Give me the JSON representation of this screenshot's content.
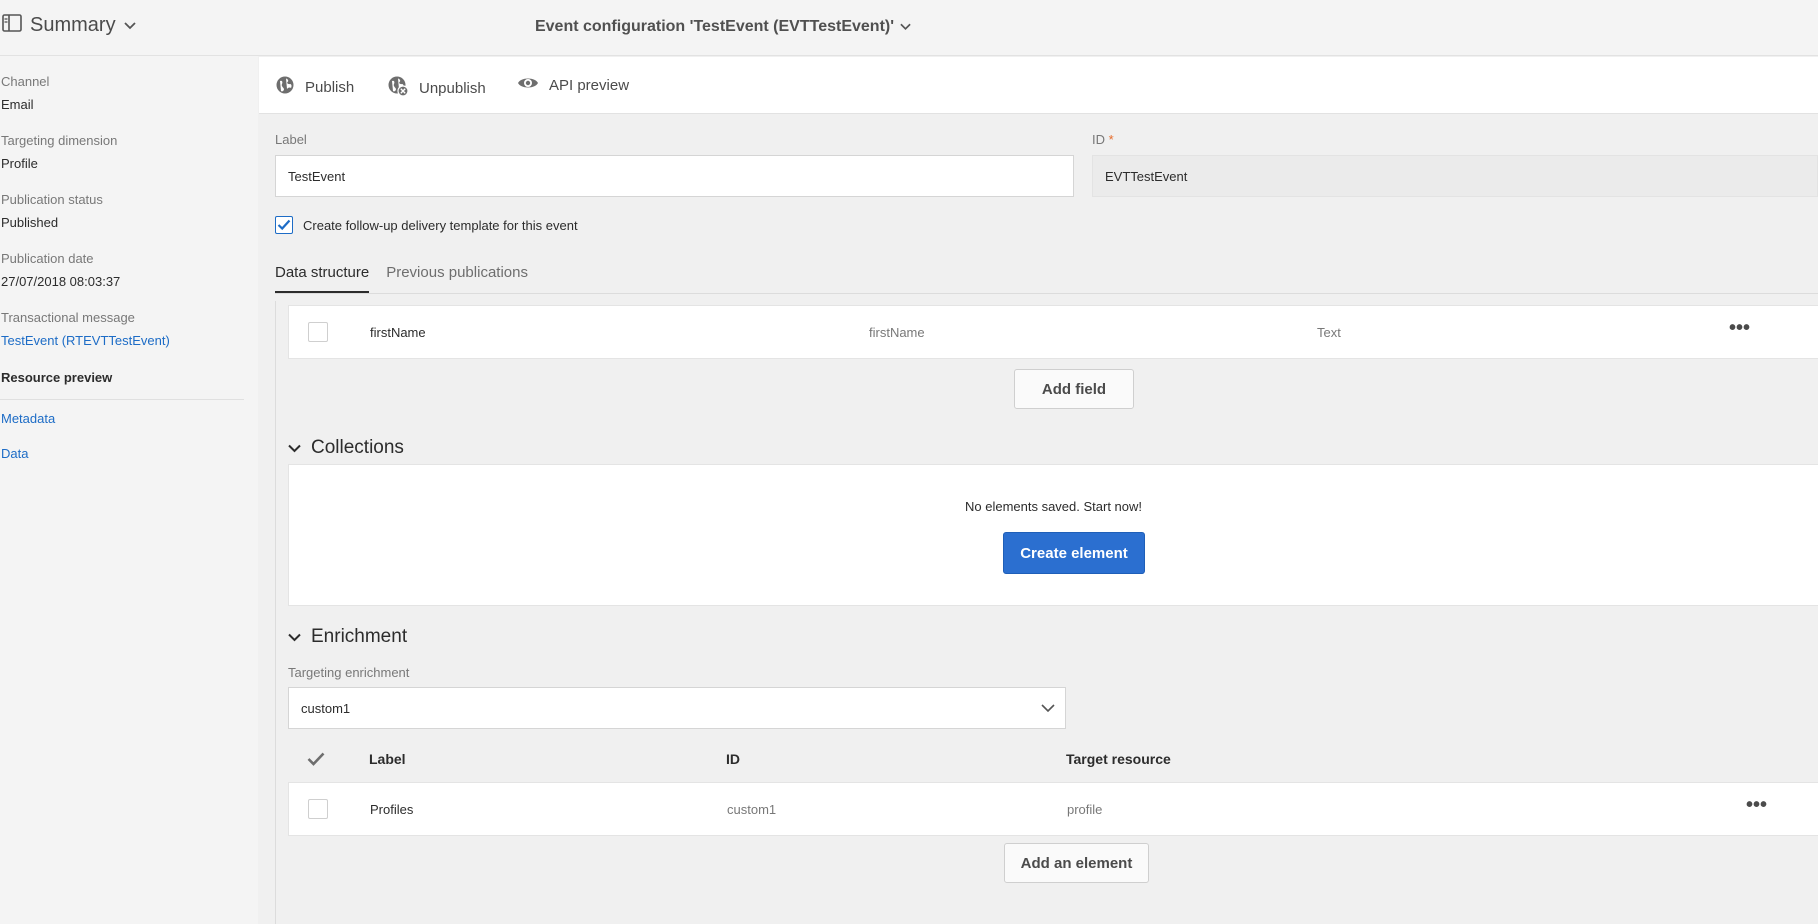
{
  "header": {
    "summary_label": "Summary",
    "title": "Event configuration 'TestEvent (EVTTestEvent)'"
  },
  "sidebar": {
    "channel_label": "Channel",
    "channel_value": "Email",
    "targeting_label": "Targeting dimension",
    "targeting_value": "Profile",
    "status_label": "Publication status",
    "status_value": "Published",
    "date_label": "Publication date",
    "date_value": "27/07/2018 08:03:37",
    "message_label": "Transactional message",
    "message_link": "TestEvent (RTEVTTestEvent)",
    "resource_preview": "Resource preview",
    "metadata_link": "Metadata",
    "data_link": "Data"
  },
  "toolbar": {
    "publish": "Publish",
    "unpublish": "Unpublish",
    "api_preview": "API preview"
  },
  "form": {
    "label_title": "Label",
    "label_value": "TestEvent",
    "id_title": "ID",
    "id_required": "*",
    "id_value": "EVTTestEvent",
    "followup_checkbox": "Create follow-up delivery template for this event",
    "followup_checked": true
  },
  "tabs": [
    {
      "label": "Data structure",
      "active": true
    },
    {
      "label": "Previous publications",
      "active": false
    }
  ],
  "fields_table": {
    "rows": [
      {
        "label": "firstName",
        "id": "firstName",
        "type": "Text"
      }
    ],
    "add_field": "Add field"
  },
  "collections": {
    "title": "Collections",
    "empty_text": "No elements saved. Start now!",
    "create_button": "Create element"
  },
  "enrichment": {
    "title": "Enrichment",
    "targeting_label": "Targeting enrichment",
    "targeting_value": "custom1",
    "columns": [
      "Label",
      "ID",
      "Target resource"
    ],
    "rows": [
      {
        "label": "Profiles",
        "id": "custom1",
        "target": "profile"
      }
    ],
    "add_button": "Add an element"
  },
  "colors": {
    "accent": "#2b6fd0",
    "link": "#1d6cc6",
    "required": "#e66b2a"
  }
}
